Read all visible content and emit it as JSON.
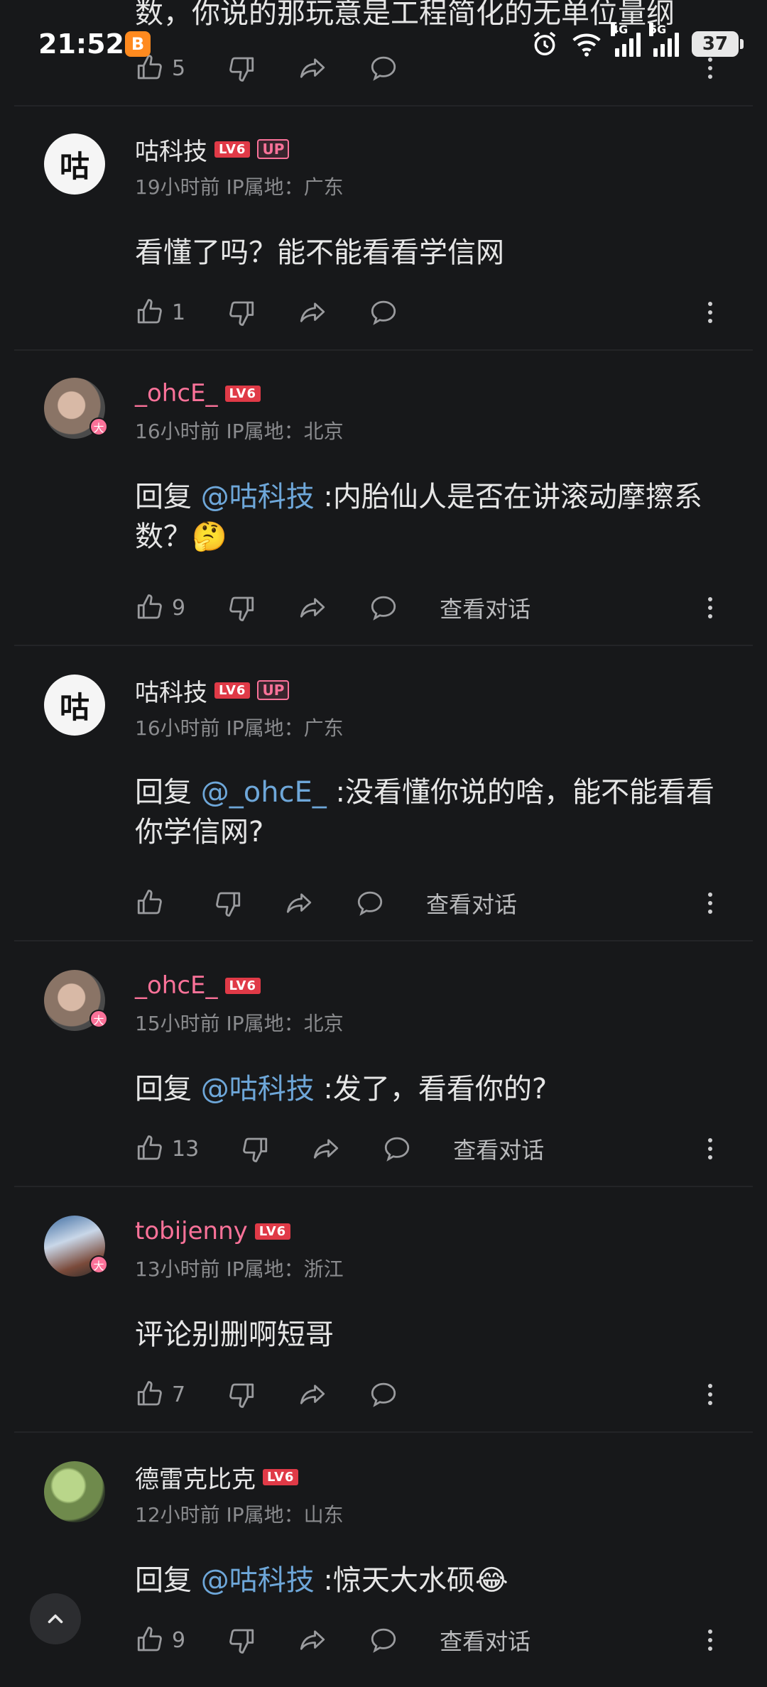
{
  "status_bar": {
    "time": "21:52",
    "app_notification": "B",
    "network_1": "4G",
    "network_2": "5G",
    "battery": "37"
  },
  "top_partial": {
    "text": "数，你说的那玩意是工程简化的无单位量纲",
    "likes": "5"
  },
  "comments": [
    {
      "username": "咕科技",
      "avatar_text": "咕",
      "level": "LV6",
      "up_badge": "UP",
      "meta": "19小时前 IP属地：广东",
      "mention": "",
      "text": "看懂了吗？能不能看看学信网",
      "likes": "1",
      "view_conversation": ""
    },
    {
      "username": "_ohcE_",
      "avatar_badge": "大",
      "level": "LV6",
      "meta": "16小时前 IP属地：北京",
      "reply_prefix": "回复 ",
      "mention": "@咕科技",
      "text": " :内胎仙人是否在讲滚动摩擦系数？🤔",
      "likes": "9",
      "view_conversation": "查看对话"
    },
    {
      "username": "咕科技",
      "avatar_text": "咕",
      "level": "LV6",
      "up_badge": "UP",
      "meta": "16小时前 IP属地：广东",
      "reply_prefix": "回复 ",
      "mention": "@_ohcE_",
      "text": " :没看懂你说的啥，能不能看看你学信网?",
      "likes": "",
      "view_conversation": "查看对话"
    },
    {
      "username": "_ohcE_",
      "avatar_badge": "大",
      "level": "LV6",
      "meta": "15小时前 IP属地：北京",
      "reply_prefix": "回复 ",
      "mention": "@咕科技",
      "text": " :发了，看看你的?",
      "likes": "13",
      "view_conversation": "查看对话"
    },
    {
      "username": "tobijenny",
      "avatar_badge": "大",
      "level": "LV6",
      "meta": "13小时前 IP属地：浙江",
      "mention": "",
      "text": "评论别删啊短哥",
      "likes": "7",
      "view_conversation": ""
    },
    {
      "username": "德雷克比克",
      "level": "LV6",
      "meta": "12小时前 IP属地：山东",
      "reply_prefix": "回复 ",
      "mention": "@咕科技",
      "text": " :惊天大水硕😂",
      "likes": "9",
      "view_conversation": "查看对话"
    }
  ],
  "colors": {
    "background": "#17181a",
    "vip_pink": "#fb7299",
    "mention_blue": "#6ea7d9",
    "meta_gray": "#8a8b8e"
  },
  "icons": [
    "thumb-up-icon",
    "thumb-down-icon",
    "share-icon",
    "reply-bubble-icon",
    "more-vertical-icon",
    "chevron-up-icon"
  ]
}
